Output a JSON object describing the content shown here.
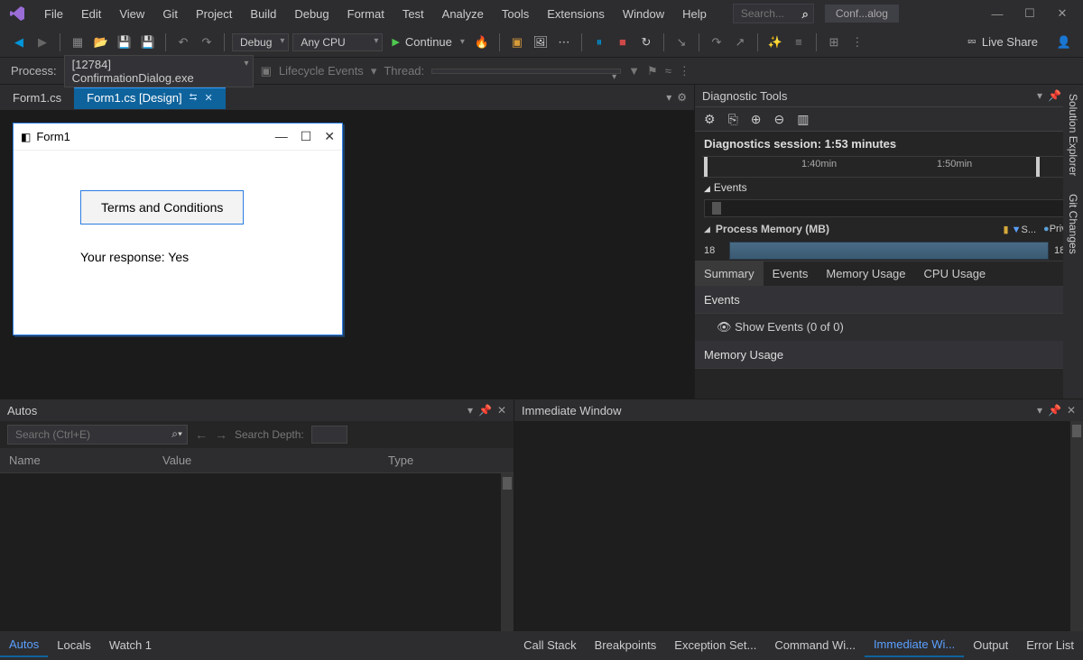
{
  "menu": [
    "File",
    "Edit",
    "View",
    "Git",
    "Project",
    "Build",
    "Debug",
    "Format",
    "Test",
    "Analyze",
    "Tools",
    "Extensions",
    "Window",
    "Help"
  ],
  "search_placeholder": "Search...",
  "app_title": "Conf...alog",
  "toolbar": {
    "config": "Debug",
    "platform": "Any CPU",
    "continue": "Continue",
    "liveshare": "Live Share"
  },
  "process": {
    "label": "Process:",
    "value": "[12784] ConfirmationDialog.exe",
    "lifecycle": "Lifecycle Events",
    "thread": "Thread:"
  },
  "tabs": {
    "inactive": "Form1.cs",
    "active": "Form1.cs [Design]"
  },
  "winform": {
    "title": "Form1",
    "button": "Terms and Conditions",
    "label": "Your response: Yes"
  },
  "diag": {
    "title": "Diagnostic Tools",
    "session": "Diagnostics session: 1:53 minutes",
    "tick1": "1:40min",
    "tick2": "1:50min",
    "events_hdr": "Events",
    "mem_hdr": "Process Memory (MB)",
    "snap": "S...",
    "priv": "Priv...",
    "mem_left": "18",
    "mem_right": "18",
    "tabs": [
      "Summary",
      "Events",
      "Memory Usage",
      "CPU Usage"
    ],
    "panel_events": "Events",
    "show_events": "Show Events (0 of 0)",
    "panel_mem": "Memory Usage"
  },
  "side": {
    "solution": "Solution Explorer",
    "git": "Git Changes"
  },
  "autos": {
    "title": "Autos",
    "search_placeholder": "Search (Ctrl+E)",
    "depth_label": "Search Depth:",
    "cols": [
      "Name",
      "Value",
      "Type"
    ]
  },
  "immediate": {
    "title": "Immediate Window"
  },
  "bottabs_left": [
    "Autos",
    "Locals",
    "Watch 1"
  ],
  "bottabs_right": [
    "Call Stack",
    "Breakpoints",
    "Exception Set...",
    "Command Wi...",
    "Immediate Wi...",
    "Output",
    "Error List"
  ]
}
